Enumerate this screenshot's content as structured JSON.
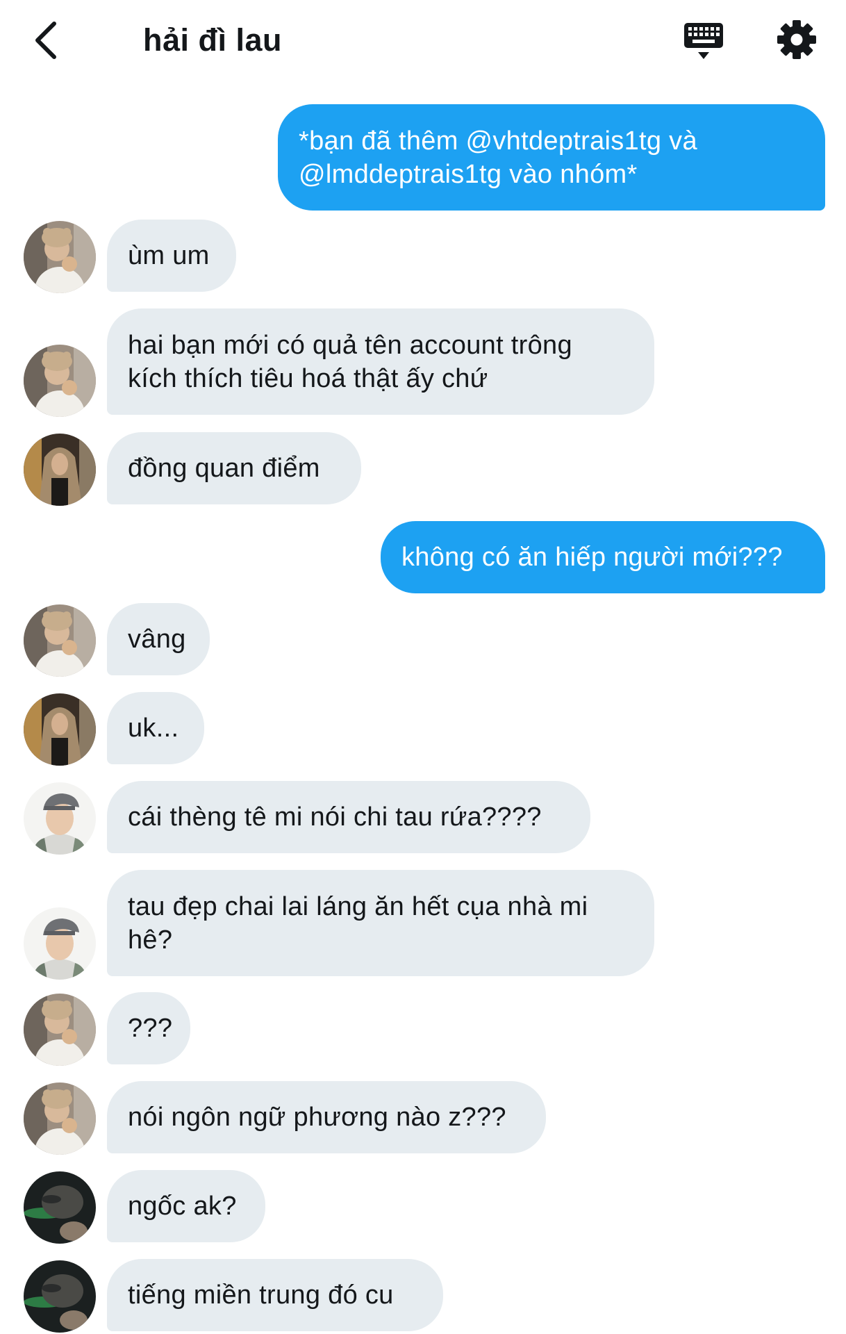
{
  "header": {
    "title": "hải đì lau",
    "back_icon": "chevron-left-icon",
    "keyboard_icon": "keyboard-icon",
    "settings_icon": "gear-icon"
  },
  "colors": {
    "outgoing_bubble": "#1da1f2",
    "incoming_bubble": "#e6ecf0",
    "text": "#14171a"
  },
  "messages": [
    {
      "side": "out",
      "text": "*bạn đã thêm @vhtdeptrais1tg và\n@lmddeptrais1tg vào nhóm*"
    },
    {
      "side": "in",
      "sender": "a",
      "text": "ùm um"
    },
    {
      "side": "in",
      "sender": "a",
      "text": "hai bạn mới có quả tên account trông\nkích thích tiêu hoá thật ấy chứ"
    },
    {
      "side": "in",
      "sender": "b",
      "text": "đồng quan điểm"
    },
    {
      "side": "out",
      "text": "không có ăn hiếp người mới???"
    },
    {
      "side": "in",
      "sender": "a",
      "text": "vâng"
    },
    {
      "side": "in",
      "sender": "b",
      "text": "uk..."
    },
    {
      "side": "in",
      "sender": "c",
      "text": "cái thèng tê mi nói chi tau rứa????"
    },
    {
      "side": "in",
      "sender": "c",
      "text": "tau đẹp chai lai láng ăn hết cụa nhà mi\nhê?"
    },
    {
      "side": "in",
      "sender": "a",
      "text": "???"
    },
    {
      "side": "in",
      "sender": "a",
      "text": "nói ngôn ngữ phương nào z???"
    },
    {
      "side": "in",
      "sender": "d",
      "text": "ngốc ak?"
    },
    {
      "side": "in",
      "sender": "d",
      "text": "tiếng miền trung đó cu"
    }
  ]
}
